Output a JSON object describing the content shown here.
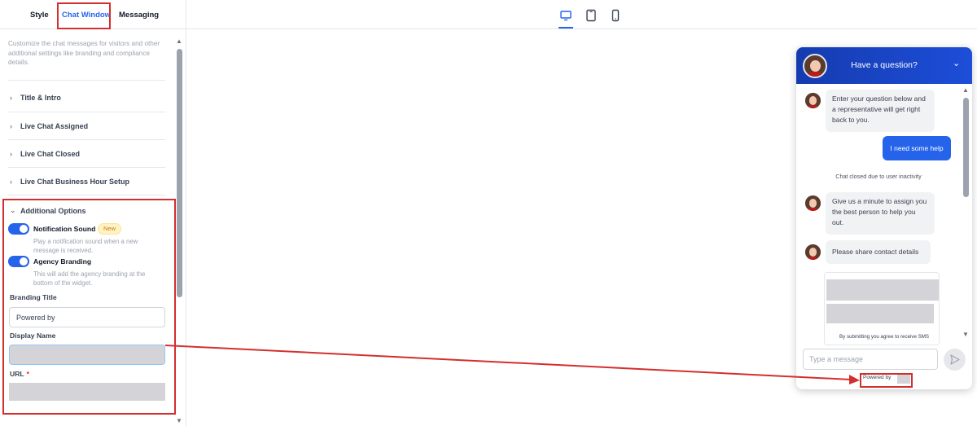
{
  "tabs": [
    "Style",
    "Chat Window",
    "Messaging"
  ],
  "description": "Customize the chat messages for visitors and other additional settings like branding and compliance details.",
  "sections": [
    "Title & Intro",
    "Live Chat Assigned",
    "Live Chat Closed",
    "Live Chat Business Hour Setup"
  ],
  "additional_options": {
    "title": "Additional Options",
    "notification": {
      "label": "Notification Sound",
      "badge": "New",
      "help": "Play a notification sound when a new message is received.",
      "enabled": true
    },
    "branding": {
      "label": "Agency Branding",
      "help": "This will add the agency branding at the bottom of the widget.",
      "enabled": true
    },
    "branding_title_label": "Branding Title",
    "branding_title_value": "Powered by",
    "display_name_label": "Display Name",
    "display_name_value": "",
    "url_label": "URL",
    "url_required": "*",
    "url_value": ""
  },
  "widget": {
    "title": "Have a question?",
    "messages": {
      "m1": "Enter your question below and a representative will get right back to you.",
      "user": "I need some help",
      "system": "Chat closed due to user inactivity",
      "m2": "Give us a minute to assign you the best person to help you out.",
      "m3": "Please share contact details",
      "form_note": "By submitting you agree to receive SMS"
    },
    "input_placeholder": "Type a message",
    "powered_by": "Powered by"
  },
  "colors": {
    "accent": "#2563eb",
    "header": "#1d4ed8",
    "annotation": "#d32f2f"
  },
  "icons": [
    "desktop-icon",
    "tablet-icon",
    "mobile-icon",
    "chevron-right-icon",
    "chevron-down-icon",
    "send-icon"
  ]
}
